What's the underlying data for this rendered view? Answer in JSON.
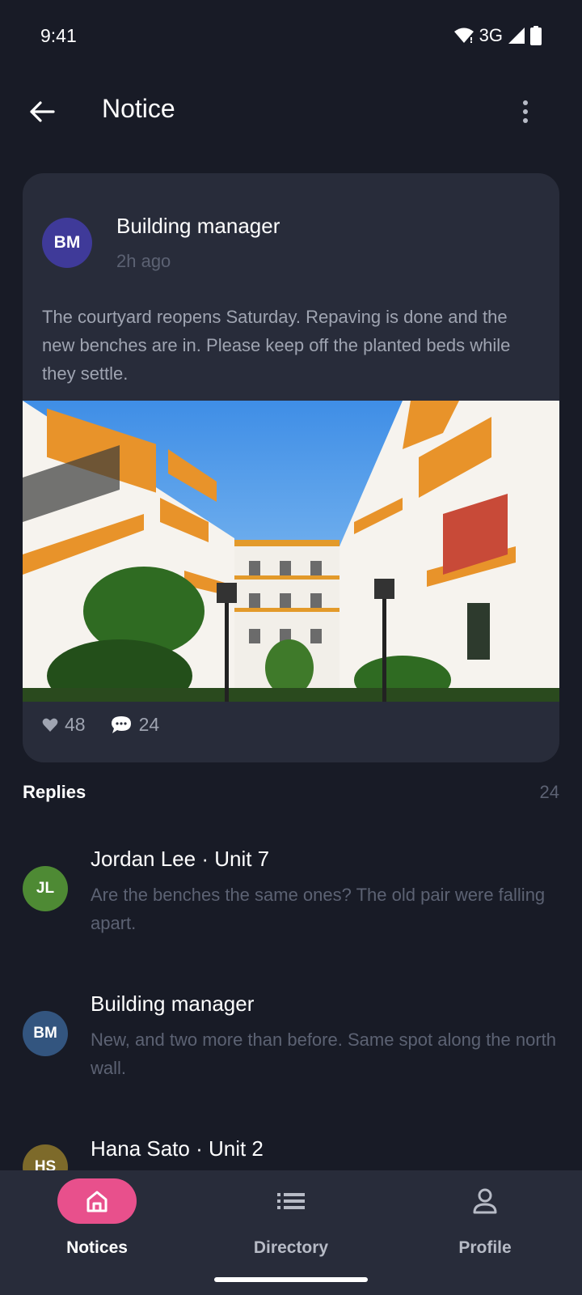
{
  "status_bar": {
    "time": "9:41",
    "network": "3G",
    "icons": [
      "wifi-icon",
      "signal-icon",
      "battery-icon"
    ]
  },
  "app_bar": {
    "title": "Notice",
    "back_icon": "arrow-left-icon",
    "more_icon": "more-vert-icon"
  },
  "post": {
    "avatar_initials": "BM",
    "author": "Building manager",
    "time": "2h ago",
    "body": "The courtyard reopens Saturday. Repaving is done and the new benches are in. Please keep off the planted beds while they settle.",
    "likes": "48",
    "comments": "24"
  },
  "replies": {
    "title": "Replies",
    "count": "24",
    "items": [
      {
        "initials": "JL",
        "name": "Jordan Lee · Unit 7",
        "text": "Are the benches the same ones? The old pair were falling apart.",
        "color": "#4e8a34"
      },
      {
        "initials": "BM",
        "name": "Building manager",
        "text": "New, and two more than before. Same spot along the north wall.",
        "color": "#33557f"
      },
      {
        "initials": "HS",
        "name": "Hana Sato · Unit 2",
        "text": "",
        "color": "#7d6a2a"
      }
    ]
  },
  "bottom_nav": {
    "items": [
      {
        "label": "Notices",
        "icon": "home-icon",
        "active": true
      },
      {
        "label": "Directory",
        "icon": "list-icon",
        "active": false
      },
      {
        "label": "Profile",
        "icon": "person-icon",
        "active": false
      }
    ]
  },
  "colors": {
    "background": "#181b26",
    "card": "#282c3a",
    "accent": "#e8508c"
  }
}
